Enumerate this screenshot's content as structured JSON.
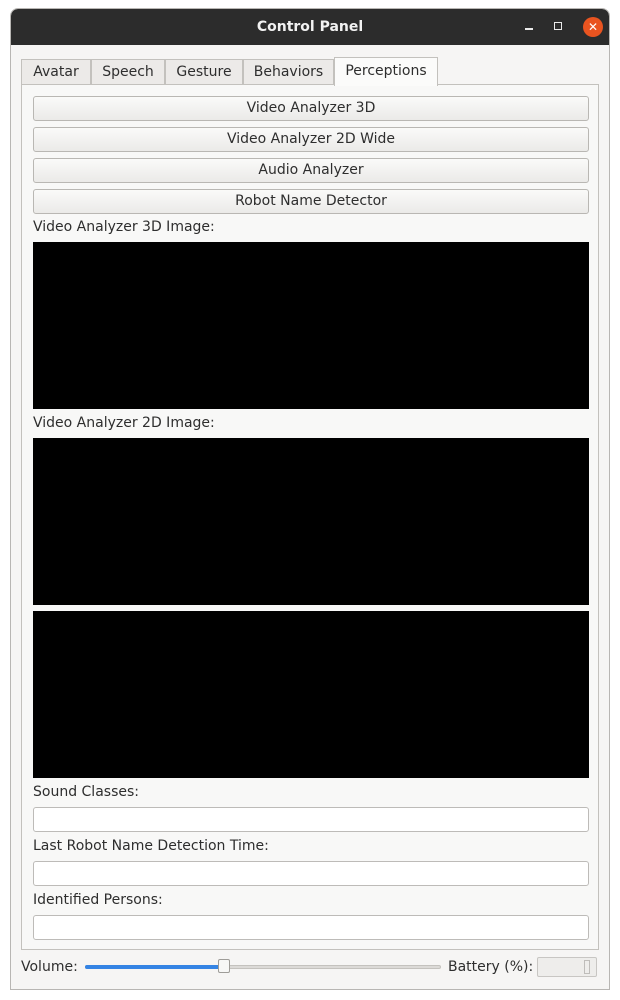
{
  "window": {
    "title": "Control Panel"
  },
  "tabs": [
    {
      "label": "Avatar",
      "active": false
    },
    {
      "label": "Speech",
      "active": false
    },
    {
      "label": "Gesture",
      "active": false
    },
    {
      "label": "Behaviors",
      "active": false
    },
    {
      "label": "Perceptions",
      "active": true
    }
  ],
  "perceptions": {
    "buttons": {
      "video_3d": "Video Analyzer 3D",
      "video_2d_wide": "Video Analyzer 2D Wide",
      "audio": "Audio Analyzer",
      "robot_name": "Robot Name Detector"
    },
    "labels": {
      "video_3d_image": "Video Analyzer 3D Image:",
      "video_2d_image": "Video Analyzer 2D Image:",
      "sound_classes": "Sound Classes:",
      "last_detection": "Last Robot Name Detection Time:",
      "identified_persons": "Identified Persons:"
    },
    "fields": {
      "sound_classes": "",
      "last_detection": "",
      "identified_persons": ""
    }
  },
  "footer": {
    "volume_label": "Volume:",
    "volume_fraction": 0.39,
    "battery_label": "Battery (%):",
    "battery_value": ""
  },
  "colors": {
    "accent": "#3584e4",
    "close": "#e95420",
    "titlebar": "#2c2c2c"
  },
  "icons": {
    "minimize": "minimize-icon",
    "maximize": "maximize-icon",
    "close": "close-icon"
  }
}
